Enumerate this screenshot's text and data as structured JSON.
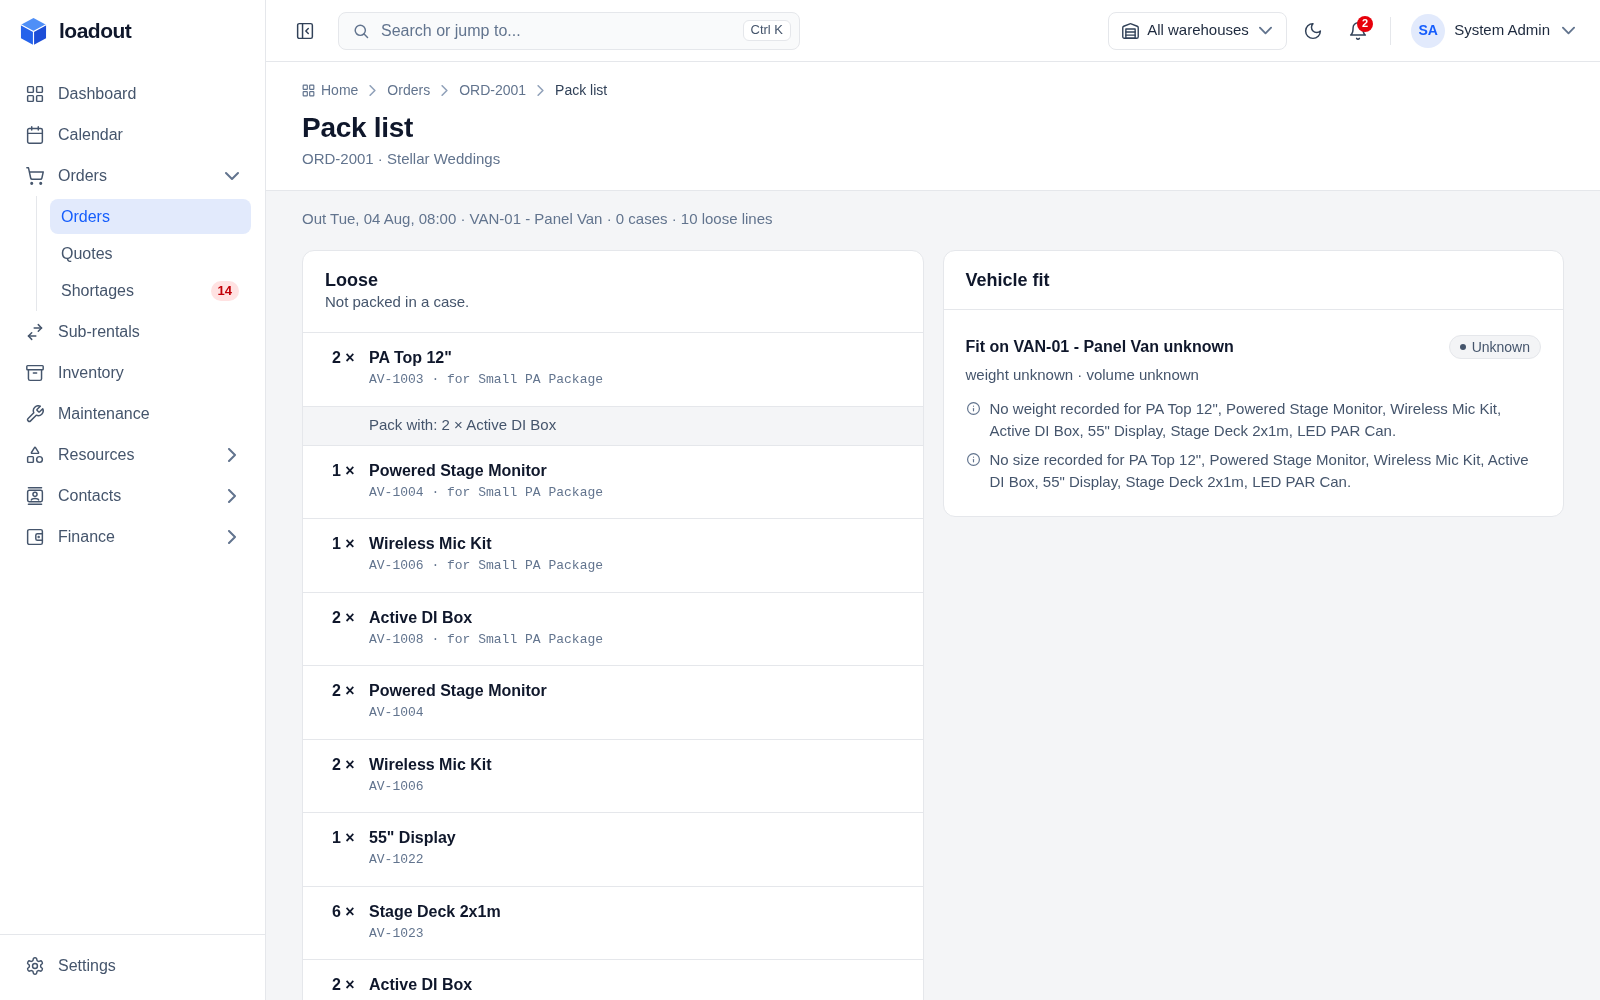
{
  "app": {
    "name": "loadout"
  },
  "sidebar": {
    "items": [
      {
        "kind": "link",
        "label": "Dashboard",
        "selected": false
      },
      {
        "kind": "link",
        "label": "Calendar",
        "selected": false
      },
      {
        "kind": "group",
        "label": "Orders",
        "selected": false,
        "expanded": true,
        "children": [
          {
            "label": "Orders",
            "selected": true
          },
          {
            "label": "Quotes",
            "selected": false
          },
          {
            "label": "Shortages",
            "selected": false,
            "badge": "14"
          }
        ]
      },
      {
        "kind": "link",
        "label": "Sub-rentals",
        "selected": false
      },
      {
        "kind": "link",
        "label": "Inventory",
        "selected": false
      },
      {
        "kind": "link",
        "label": "Maintenance",
        "selected": false
      },
      {
        "kind": "group",
        "label": "Resources",
        "selected": false,
        "expanded": false
      },
      {
        "kind": "group",
        "label": "Contacts",
        "selected": false,
        "expanded": false
      },
      {
        "kind": "group",
        "label": "Finance",
        "selected": false,
        "expanded": false
      }
    ],
    "footer": {
      "label": "Settings",
      "selected": false
    }
  },
  "top_bar": {
    "search": {
      "placeholder": "Search or jump to...",
      "shortcut": "Ctrl K"
    },
    "warehouse_select": {
      "value": "All warehouses"
    },
    "notifications": {
      "count": "2"
    },
    "user": {
      "initials": "SA",
      "name": "System Admin"
    }
  },
  "breadcrumb": [
    "Home",
    "Orders",
    "ORD-2001",
    "Pack list"
  ],
  "page": {
    "title": "Pack list",
    "subtitle": "ORD-2001 · Stellar Weddings",
    "summary": "Out Tue, 04 Aug, 08:00 · VAN-01 - Panel Van · 0 cases · 10 loose lines"
  },
  "loose": {
    "title": "Loose",
    "subtitle": "Not packed in a case.",
    "lines": [
      {
        "qty": "2 ×",
        "name": "PA Top 12\"",
        "code": "AV-1003 · for Small PA Package",
        "pack_with": "Pack with: 2 × Active DI Box"
      },
      {
        "qty": "1 ×",
        "name": "Powered Stage Monitor",
        "code": "AV-1004 · for Small PA Package"
      },
      {
        "qty": "1 ×",
        "name": "Wireless Mic Kit",
        "code": "AV-1006 · for Small PA Package"
      },
      {
        "qty": "2 ×",
        "name": "Active DI Box",
        "code": "AV-1008 · for Small PA Package"
      },
      {
        "qty": "2 ×",
        "name": "Powered Stage Monitor",
        "code": "AV-1004"
      },
      {
        "qty": "2 ×",
        "name": "Wireless Mic Kit",
        "code": "AV-1006"
      },
      {
        "qty": "1 ×",
        "name": "55\" Display",
        "code": "AV-1022"
      },
      {
        "qty": "6 ×",
        "name": "Stage Deck 2x1m",
        "code": "AV-1023"
      },
      {
        "qty": "2 ×",
        "name": "Active DI Box"
      }
    ]
  },
  "vehicle_fit": {
    "title": "Vehicle fit",
    "fit_title": "Fit on VAN-01 - Panel Van unknown",
    "status": "Unknown",
    "detail": "weight unknown · volume unknown",
    "notes": [
      "No weight recorded for PA Top 12\", Powered Stage Monitor, Wireless Mic Kit, Active DI Box, 55\" Display, Stage Deck 2x1m, LED PAR Can.",
      "No size recorded for PA Top 12\", Powered Stage Monitor, Wireless Mic Kit, Active DI Box, 55\" Display, Stage Deck 2x1m, LED PAR Can."
    ]
  }
}
